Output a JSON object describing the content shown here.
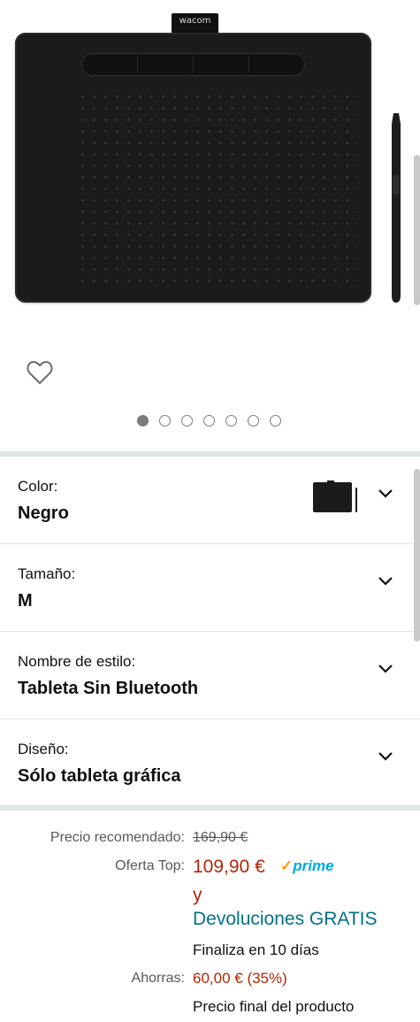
{
  "gallery": {
    "logo_text": "wacom",
    "dot_count": 7,
    "active_dot": 0
  },
  "variations": [
    {
      "label": "Color:",
      "value": "Negro"
    },
    {
      "label": "Tamaño:",
      "value": "M"
    },
    {
      "label": "Nombre de estilo:",
      "value": "Tableta Sin Bluetooth"
    },
    {
      "label": "Diseño:",
      "value": "Sólo tableta gráfica"
    }
  ],
  "price": {
    "list_label": "Precio recomendado:",
    "list_value": "169,90 €",
    "deal_label": "Oferta Top:",
    "deal_value": "109,90 €",
    "prime_text": "prime",
    "conjunction": "y",
    "returns": "Devoluciones GRATIS",
    "ends": "Finaliza en 10 días",
    "savings_label": "Ahorras:",
    "savings_value": "60,00 € (35%)",
    "final_note": "Precio final del producto"
  },
  "colors": {
    "price_red": "#b12704",
    "link_teal": "#007185",
    "prime_blue": "#00a8e1",
    "prime_check": "#ff9900"
  }
}
